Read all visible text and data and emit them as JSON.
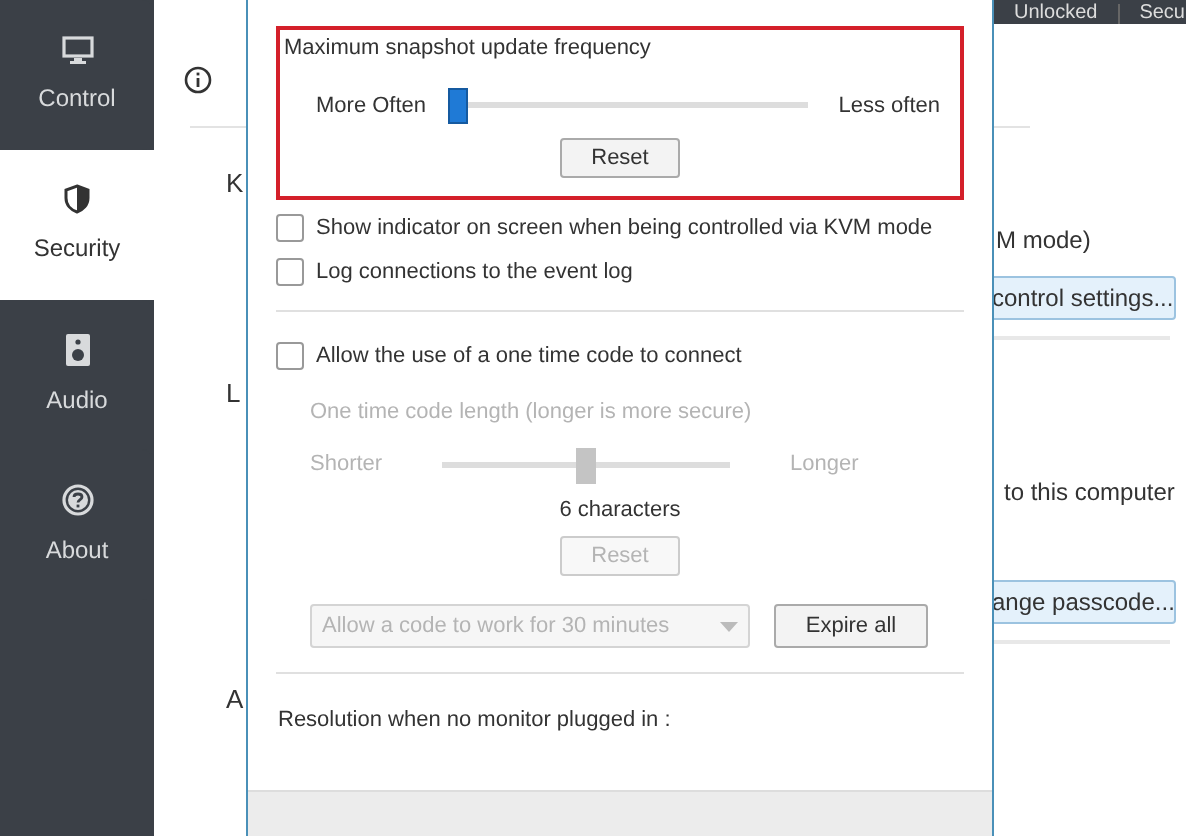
{
  "sidebar": {
    "items": [
      {
        "label": "Control",
        "selected": false
      },
      {
        "label": "Security",
        "selected": true
      },
      {
        "label": "Audio",
        "selected": false
      },
      {
        "label": "About",
        "selected": false
      }
    ]
  },
  "background_window": {
    "header_tabs": [
      "Unlocked",
      "Secu"
    ],
    "headings": [
      "K",
      "L",
      "A"
    ],
    "texts": [
      "M mode)",
      "to this computer"
    ],
    "buttons": [
      "control settings...",
      "ange passcode..."
    ]
  },
  "dialog": {
    "frequency": {
      "title": "Maximum snapshot update frequency",
      "left_label": "More Often",
      "right_label": "Less often",
      "level": 0,
      "reset": "Reset"
    },
    "options": [
      {
        "label": "Show indicator on screen when being controlled via KVM mode",
        "checked": false
      },
      {
        "label": "Log connections to the event log",
        "checked": false
      }
    ],
    "one_time_code": {
      "label": "Allow the use of a one time code to connect",
      "checked": false,
      "length_label": "One time code length (longer is more secure)",
      "left_label": "Shorter",
      "right_label": "Longer",
      "level": 0.5,
      "value": "6 characters",
      "reset": "Reset",
      "disabled": true,
      "duration": "Allow a code to work for 30 minutes",
      "expire": "Expire all"
    },
    "resolution_label": "Resolution when no monitor plugged in :"
  }
}
